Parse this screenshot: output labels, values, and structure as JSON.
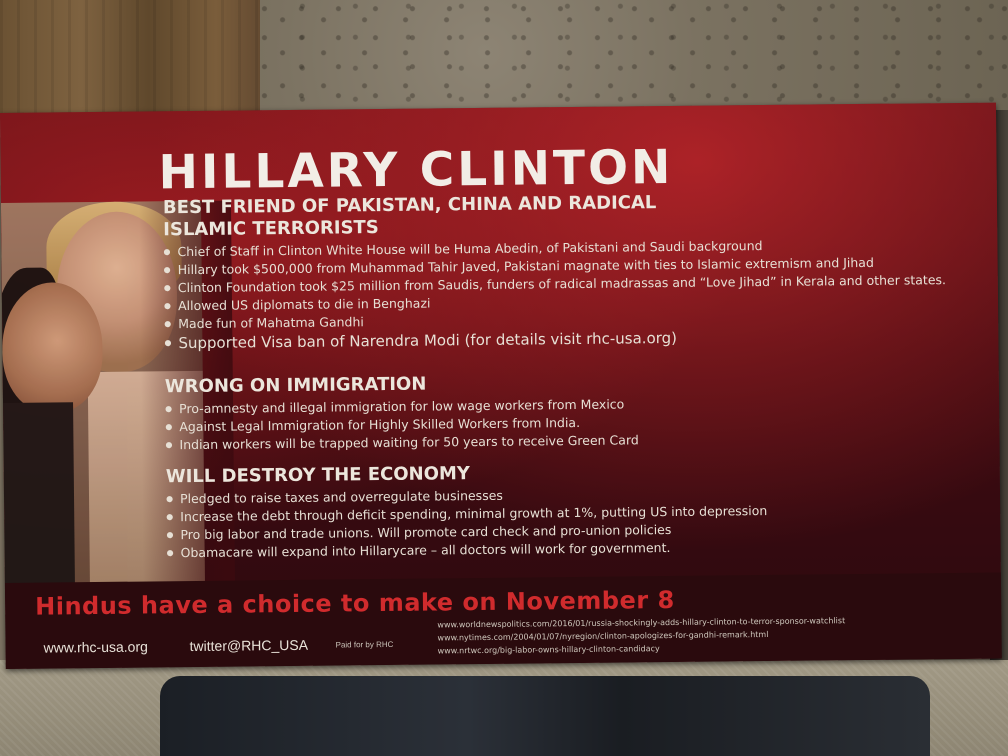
{
  "flyer": {
    "title": "HILLARY CLINTON",
    "sections": [
      {
        "heading": "BEST FRIEND OF PAKISTAN, CHINA AND RADICAL ISLAMIC TERRORISTS",
        "items": [
          "Chief of Staff in Clinton White House will be Huma Abedin, of Pakistani and Saudi background",
          "Hillary took $500,000 from Muhammad Tahir Javed, Pakistani magnate with ties to Islamic extremism  and Jihad",
          "Clinton Foundation took $25 million from Saudis, funders of radical madrassas and “Love Jihad” in Kerala and other states.",
          "Allowed US diplomats to die in Benghazi",
          "Made fun of Mahatma Gandhi",
          "Supported Visa ban of Narendra Modi (for details visit rhc-usa.org)"
        ]
      },
      {
        "heading": "WRONG ON IMMIGRATION",
        "items": [
          "Pro-amnesty and illegal immigration for low wage workers from Mexico",
          "Against Legal Immigration for Highly Skilled Workers from India.",
          "Indian workers will be trapped waiting for 50 years to receive Green Card"
        ]
      },
      {
        "heading": "WILL DESTROY THE ECONOMY",
        "items": [
          "Pledged to raise taxes and overregulate businesses",
          "Increase the debt through deficit spending, minimal growth at 1%, putting US into depression",
          "Pro big labor and trade unions. Will promote card check and pro-union policies",
          "Obamacare will expand into Hillarycare – all doctors will work for government."
        ]
      }
    ],
    "choice": "Hindus have a choice to make on November 8",
    "footer": {
      "website": "www.rhc-usa.org",
      "twitter": "twitter@RHC_USA",
      "paid_by": "Paid for by RHC",
      "sources": [
        "www.worldnewspolitics.com/2016/01/russia-shockingly-adds-hillary-clinton-to-terror-sponsor-watchlist",
        "www.nytimes.com/2004/01/07/nyregion/clinton-apologizes-for-gandhi-remark.html",
        "www.nrtwc.org/big-labor-owns-hillary-clinton-candidacy"
      ]
    }
  }
}
